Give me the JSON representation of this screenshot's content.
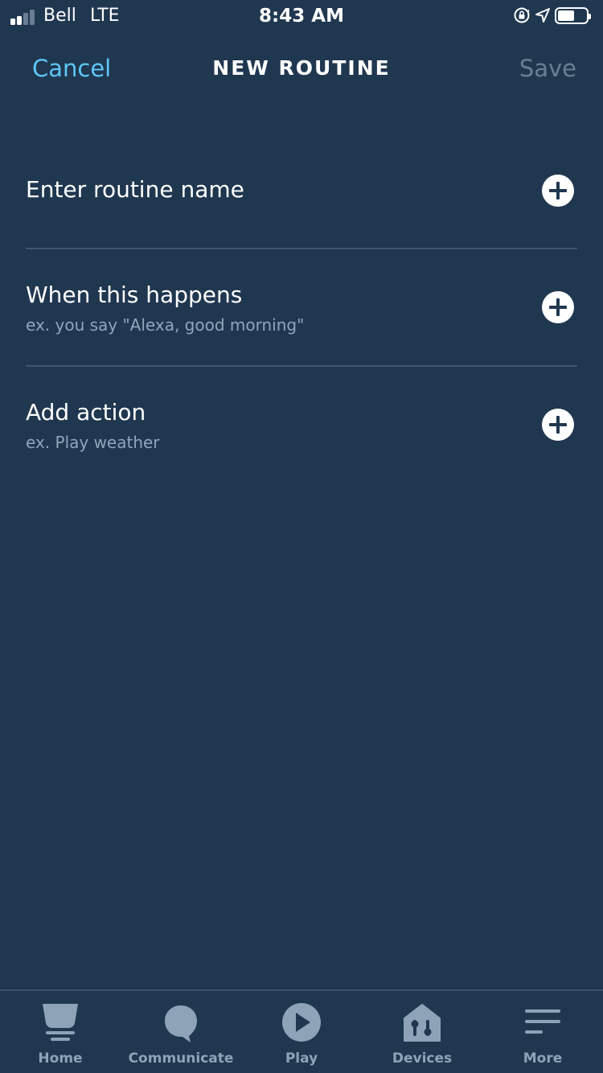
{
  "status_bar": {
    "carrier": "Bell",
    "network": "LTE",
    "time": "8:43 AM",
    "icons": [
      "signal-icon",
      "orientation-lock-icon",
      "location-icon",
      "battery-icon"
    ]
  },
  "header": {
    "cancel_label": "Cancel",
    "title": "NEW ROUTINE",
    "save_label": "Save"
  },
  "rows": [
    {
      "title": "Enter routine name",
      "subtitle": "",
      "icon": "plus-circle-icon"
    },
    {
      "title": "When this happens",
      "subtitle": "ex. you say \"Alexa, good morning\"",
      "icon": "plus-circle-icon"
    },
    {
      "title": "Add action",
      "subtitle": "ex. Play weather",
      "icon": "plus-circle-icon"
    }
  ],
  "tabbar": {
    "tabs": [
      {
        "label": "Home",
        "icon": "home-icon"
      },
      {
        "label": "Communicate",
        "icon": "speech-bubble-icon"
      },
      {
        "label": "Play",
        "icon": "play-icon"
      },
      {
        "label": "Devices",
        "icon": "devices-house-icon"
      },
      {
        "label": "More",
        "icon": "menu-lines-icon"
      }
    ]
  },
  "colors": {
    "background": "#203750",
    "accent": "#5ec7f6",
    "text": "#ffffff",
    "subtext": "#90a6bd",
    "disabled": "#6b7f93",
    "tab_inactive": "#8ea3b8",
    "divider": "#3f5770"
  }
}
